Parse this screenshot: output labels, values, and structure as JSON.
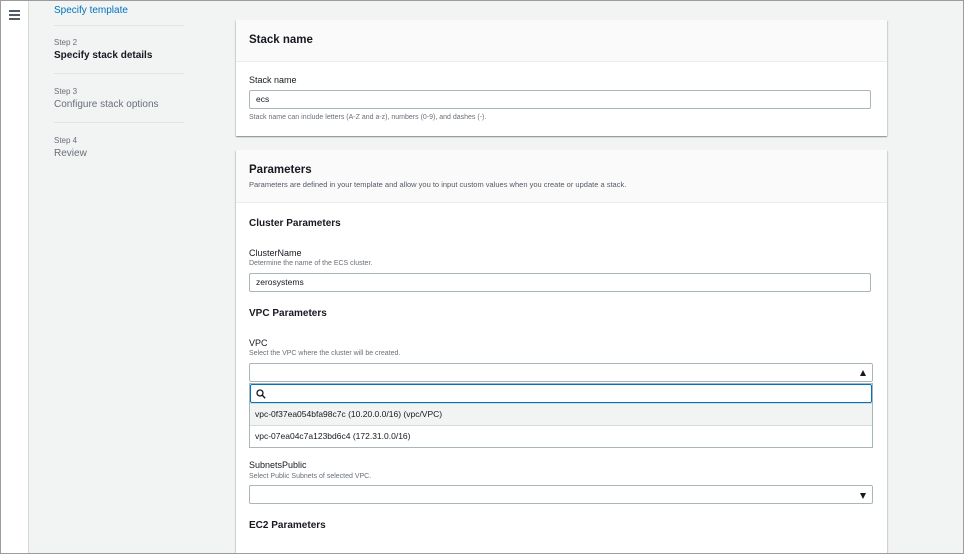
{
  "steps": [
    {
      "num": "",
      "title": "Specify template"
    },
    {
      "num": "Step 2",
      "title": "Specify stack details"
    },
    {
      "num": "Step 3",
      "title": "Configure stack options"
    },
    {
      "num": "Step 4",
      "title": "Review"
    }
  ],
  "stack_panel": {
    "title": "Stack name",
    "field_label": "Stack name",
    "field_value": "ecs",
    "hint": "Stack name can include letters (A-Z and a-z), numbers (0-9), and dashes (-)."
  },
  "params_panel": {
    "title": "Parameters",
    "description": "Parameters are defined in your template and allow you to input custom values when you create or update a stack.",
    "cluster": {
      "section_title": "Cluster Parameters",
      "label": "ClusterName",
      "hint": "Determine the name of the ECS cluster.",
      "value": "zerosystems"
    },
    "vpc": {
      "section_title": "VPC Parameters",
      "label": "VPC",
      "hint": "Select the VPC where the cluster will be created.",
      "search_value": "",
      "options": [
        "vpc-0f37ea054bfa98c7c (10.20.0.0/16) (vpc/VPC)",
        "vpc-07ea04c7a123bd6c4 (172.31.0.0/16)"
      ]
    },
    "subnets": {
      "label": "SubnetsPublic",
      "hint": "Select Public Subnets of selected VPC."
    },
    "ec2": {
      "section_title": "EC2 Parameters"
    }
  },
  "icons": {
    "menu": "hamburger-menu-icon",
    "search": "search-icon",
    "caret_up": "caret-up-icon",
    "caret_down": "caret-down-icon"
  },
  "colors": {
    "link": "#0073bb",
    "focus": "#0073bb",
    "background": "#f2f3f3"
  }
}
